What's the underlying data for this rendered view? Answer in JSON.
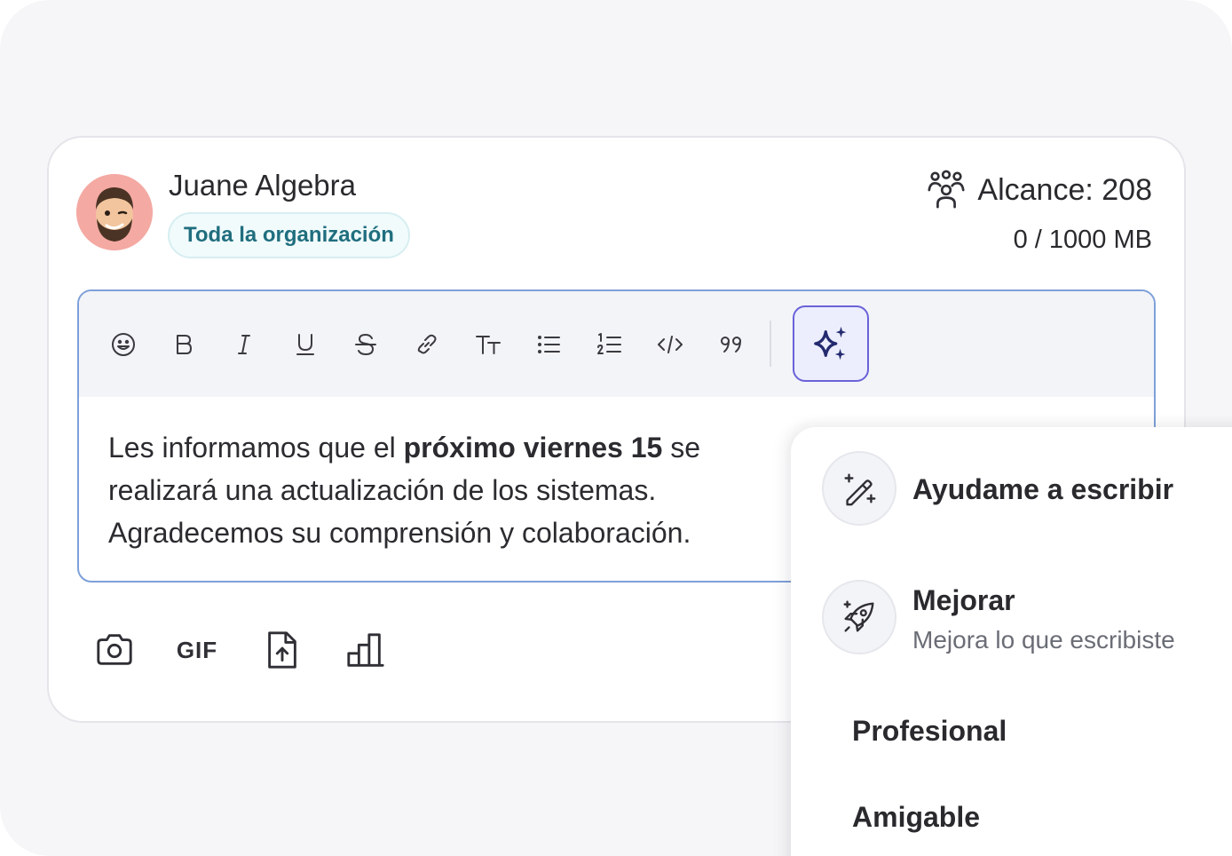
{
  "post": {
    "author_name": "Juane Algebra",
    "audience": "Toda la organización",
    "reach_label": "Alcance: 208",
    "storage": "0 / 1000 MB"
  },
  "toolbar": {
    "buttons": [
      "emoji-icon",
      "bold-icon",
      "italic-icon",
      "underline-icon",
      "strikethrough-icon",
      "link-icon",
      "text-size-icon",
      "bulleted-list-icon",
      "numbered-list-icon",
      "code-icon",
      "quote-icon"
    ],
    "ai_button_icon": "sparkles-icon"
  },
  "editor": {
    "text_before": "Les informamos que el ",
    "text_bold": "próximo viernes 15",
    "text_after": " se realizará una actualización de los sistemas. Agradecemos su comprensión y colaboración."
  },
  "attachments": {
    "gif_label": "GIF",
    "icons": [
      "camera-icon",
      "gif-icon",
      "file-upload-icon",
      "chart-icon"
    ]
  },
  "ai_menu": {
    "help_write_title": "Ayudame a escribir",
    "improve_title": "Mejorar",
    "improve_subtitle": "Mejora lo que escribiste",
    "options": [
      "Profesional",
      "Amigable"
    ]
  },
  "colors": {
    "editor_border": "#7ea0d9",
    "ai_button_border": "#6a62d8",
    "audience_text": "#1f6e7e",
    "avatar_bg": "#f4a9a3"
  }
}
